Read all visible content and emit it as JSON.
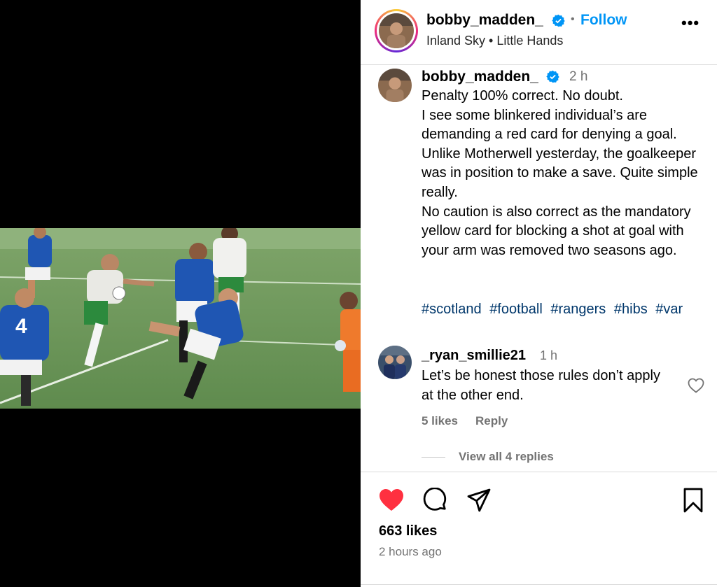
{
  "post": {
    "username": "bobby_madden_",
    "follow_label": "Follow",
    "separator": "•",
    "audio": "Inland Sky • Little Hands",
    "more_label": "•••"
  },
  "caption": {
    "username": "bobby_madden_",
    "time": "2 h",
    "lines": [
      "Penalty 100% correct. No doubt.",
      "I see some blinkered individual’s are demanding a red card for denying a goal. Unlike Motherwell yesterday, the goalkeeper was in position to make a save. Quite simple really.",
      "No caution is also correct as the mandatory yellow card for blocking a shot at goal with your arm was removed two seasons ago."
    ],
    "hashtags": [
      "#scotland",
      "#football",
      "#rangers",
      "#hibs",
      "#var"
    ]
  },
  "comment": {
    "username": "_ryan_smillie21",
    "time": "1 h",
    "text": "Let’s be honest those rules don’t apply at the other end.",
    "likes": "5 likes",
    "reply_label": "Reply",
    "view_replies": "View all 4 replies"
  },
  "footer": {
    "likes": "663 likes",
    "posted": "2 hours ago"
  },
  "media": {
    "shirt_number": "4"
  },
  "colors": {
    "accent": "#0095f6",
    "like_red": "#ff3040",
    "hashtag": "#00376b",
    "muted": "#737373"
  },
  "icons": [
    "verified-badge-icon",
    "more-options-icon",
    "heart-filled-icon",
    "comment-bubble-icon",
    "share-paper-plane-icon",
    "bookmark-icon",
    "heart-outline-icon"
  ]
}
